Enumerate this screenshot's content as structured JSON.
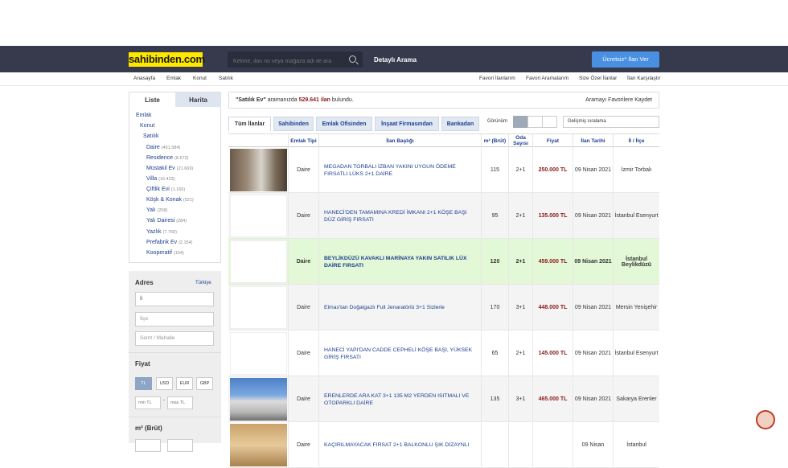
{
  "header": {
    "logo": "sahibinden.com",
    "search_placeholder": "Kelime, ilan no veya mağaza adı ile ara",
    "detail_search": "Detaylı Arama",
    "cta": "Ücretsiz* İlan Ver"
  },
  "subnav": {
    "left": [
      "Anasayfa",
      "Emlak",
      "Konut",
      "Satılık"
    ],
    "right": [
      "Favori İlanlarım",
      "Favori Aramalarım",
      "Size Özel İlanlar",
      "İlan Karşılaştır"
    ]
  },
  "sidebar": {
    "tabs": [
      "Liste",
      "Harita"
    ],
    "categories": [
      {
        "label": "Emlak",
        "count": ""
      },
      {
        "label": "Konut",
        "count": ""
      },
      {
        "label": "Satılık",
        "count": ""
      },
      {
        "label": "Daire",
        "count": "(451.584)"
      },
      {
        "label": "Residence",
        "count": "(8.672)"
      },
      {
        "label": "Müstakil Ev",
        "count": "(21.669)"
      },
      {
        "label": "Villa",
        "count": "(15.423)"
      },
      {
        "label": "Çiftlik Evi",
        "count": "(1.160)"
      },
      {
        "label": "Köşk & Konak",
        "count": "(521)"
      },
      {
        "label": "Yalı",
        "count": "(258)"
      },
      {
        "label": "Yalı Dairesi",
        "count": "(284)"
      },
      {
        "label": "Yazlık",
        "count": "(7.760)"
      },
      {
        "label": "Prefabrik Ev",
        "count": "(2.154)"
      },
      {
        "label": "Kooperatif",
        "count": "(154)"
      }
    ]
  },
  "filters": {
    "adres_label": "Adres",
    "country": "Türkiye",
    "il_placeholder": "İl",
    "ilce_placeholder": "İlçe",
    "semt_placeholder": "Semt / Mahalle",
    "fiyat_label": "Fiyat",
    "currencies": [
      "TL",
      "USD",
      "EUR",
      "GBP"
    ],
    "min_placeholder": "min TL",
    "max_placeholder": "max TL",
    "separator": "-",
    "m2_label": "m² (Brüt)"
  },
  "results": {
    "query": "\"Satılık Ev\"",
    "query_suffix": " aramanızda ",
    "count": "529.641 ilan",
    "count_suffix": " bulundu.",
    "save_search": "Aramayı Favorilere Kaydet",
    "tabs": [
      "Tüm İlanlar",
      "Sahibinden",
      "Emlak Ofisinden",
      "İnşaat Firmasından",
      "Bankadan"
    ],
    "view_label": "Görünüm",
    "sort": "Gelişmiş sıralama",
    "columns": [
      "Emlak Tipi",
      "İlan Başlığı",
      "m² (Brüt)",
      "Oda Sayısı",
      "Fiyat",
      "İlan Tarihi",
      "İl / İlçe"
    ],
    "rows": [
      {
        "type": "Daire",
        "title": "MEGADAN TORBALI İZBAN YAKINI UYGUN ÖDEME FIRSATLI LÜKS 2+1 DAİRE",
        "m2": "115",
        "rooms": "2+1",
        "price": "250.000 TL",
        "date": "09 Nisan 2021",
        "loc": "İzmir Torbalı",
        "thumb": "photo-interior"
      },
      {
        "type": "Daire",
        "title": "HANECİ'DEN TAMAMINA KREDİ İMKANI 2+1 KÖŞE BAŞI DÜZ GİRİŞ FIRSATI",
        "m2": "95",
        "rooms": "2+1",
        "price": "135.000 TL",
        "date": "09 Nisan 2021",
        "loc": "İstanbul Esenyurt",
        "thumb": "blank"
      },
      {
        "type": "Daire",
        "title": "BEYLİKDÜZÜ KAVAKLI MARİNAYA YAKIN SATILIK LÜX DAİRE FIRSATI",
        "m2": "120",
        "rooms": "2+1",
        "price": "459.000 TL",
        "date": "09 Nisan 2021",
        "loc": "İstanbul Beylikdüzü",
        "thumb": "blank"
      },
      {
        "type": "Daire",
        "title": "Elmas'tan Doğalgazlı Full Jenaratörlü 3+1 Sizlerle",
        "m2": "170",
        "rooms": "3+1",
        "price": "448.000 TL",
        "date": "09 Nisan 2021",
        "loc": "Mersin Yenişehir",
        "thumb": "blank"
      },
      {
        "type": "Daire",
        "title": "HANECİ YAPI'DAN CADDE CEPHELİ KÖŞE BAŞI, YÜKSEK GİRİŞ FIRSATI",
        "m2": "65",
        "rooms": "2+1",
        "price": "145.000 TL",
        "date": "09 Nisan 2021",
        "loc": "İstanbul Esenyurt",
        "thumb": "blank"
      },
      {
        "type": "Daire",
        "title": "ERENLERDE ARA KAT 3+1 135 M2 YERDEN ISITMALI VE OTOPARKLI DAİRE",
        "m2": "135",
        "rooms": "3+1",
        "price": "465.000 TL",
        "date": "09 Nisan 2021",
        "loc": "Sakarya Erenler",
        "thumb": "photo-building"
      },
      {
        "type": "Daire",
        "title": "KAÇIRILMAYACAK FIRSAT 2+1 BALKONLU ŞIK DİZAYNLI",
        "m2": "",
        "rooms": "",
        "price": "",
        "date": "09 Nisan",
        "loc": "İstanbul",
        "thumb": "photo-room"
      }
    ]
  },
  "colors": {
    "topbar": "#363a4c",
    "logo_bg": "#ffe800",
    "cta": "#4a90e2",
    "link": "#1c3f8f",
    "price": "#8b1a1a",
    "highlight_row": "#e3f8d6"
  }
}
